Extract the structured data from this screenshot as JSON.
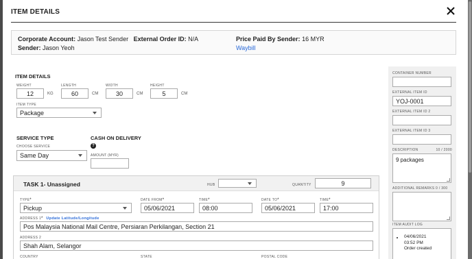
{
  "modal": {
    "title": "ITEM DETAILS"
  },
  "summary": {
    "corporate_label": "Corporate Account:",
    "corporate_value": "Jason Test Sender",
    "external_order_label": "External Order ID:",
    "external_order_value": "N/A",
    "sender_label": "Sender:",
    "sender_value": "Jason Yeoh",
    "price_label": "Price Paid By Sender:",
    "price_value": "16 MYR",
    "waybill_link": "Waybill"
  },
  "item": {
    "heading": "ITEM DETAILS",
    "weight_label": "WEIGHT",
    "weight_value": "12",
    "weight_unit": "KG",
    "length_label": "LENGTH",
    "length_value": "60",
    "length_unit": "CM",
    "width_label": "WIDTH",
    "width_value": "30",
    "width_unit": "CM",
    "height_label": "HEIGHT",
    "height_value": "5",
    "height_unit": "CM",
    "type_label": "ITEM TYPE",
    "type_value": "Package"
  },
  "service": {
    "heading": "SERVICE TYPE",
    "choose_label": "CHOOSE SERVICE",
    "choose_value": "Same Day",
    "cod_heading": "CASH ON DELIVERY",
    "help_glyph": "?",
    "amount_label": "AMOUNT (MYR)",
    "amount_value": ""
  },
  "task": {
    "title": "TASK 1- Unassigned",
    "hub_label": "HUB",
    "hub_value": "",
    "quantity_label": "QUANTITY",
    "quantity_value": "9",
    "type_label": "TYPE",
    "type_value": "Pickup",
    "date_from_label": "DATE FROM",
    "date_from_value": "05/06/2021",
    "time_from_label": "TIME",
    "time_from_value": "08:00",
    "date_to_label": "DATE TO",
    "date_to_value": "05/06/2021",
    "time_to_label": "TIME",
    "time_to_value": "17:00",
    "address1_label": "ADDRESS 1",
    "address1_link": "Update Latitude/Longitude",
    "address1_value": "Pos Malaysia National Mail Centre, Persiaran Perkilangan, Section 21",
    "address2_label": "ADDRESS 2",
    "address2_value": "Shah Alam, Selangor",
    "country_label": "COUNTRY",
    "state_label": "STATE",
    "postal_label": "POSTAL CODE",
    "required_mark": "*"
  },
  "sidebar": {
    "container_label": "CONTAINER NUMBER",
    "container_value": "",
    "ext_id_label": "EXTERNAL ITEM ID",
    "ext_id_value": "YOJ-0001",
    "ext_id2_label": "EXTERNAL ITEM ID 2",
    "ext_id2_value": "",
    "ext_id3_label": "EXTERNAL ITEM ID 3",
    "ext_id3_value": "",
    "description_label": "DESCRIPTION",
    "description_count": "10 / 2000",
    "description_value": "9 packages",
    "remarks_label": "ADDITIONAL REMARKS",
    "remarks_count": "0 / 300",
    "remarks_value": "",
    "audit_label": "ITEM AUDIT LOG",
    "audit_date": "04/06/2021",
    "audit_time": "03:52 PM",
    "audit_event": "Order created"
  },
  "icons": {
    "close": "close-icon",
    "dropdown": "chevron-down-icon",
    "help": "help-icon"
  }
}
